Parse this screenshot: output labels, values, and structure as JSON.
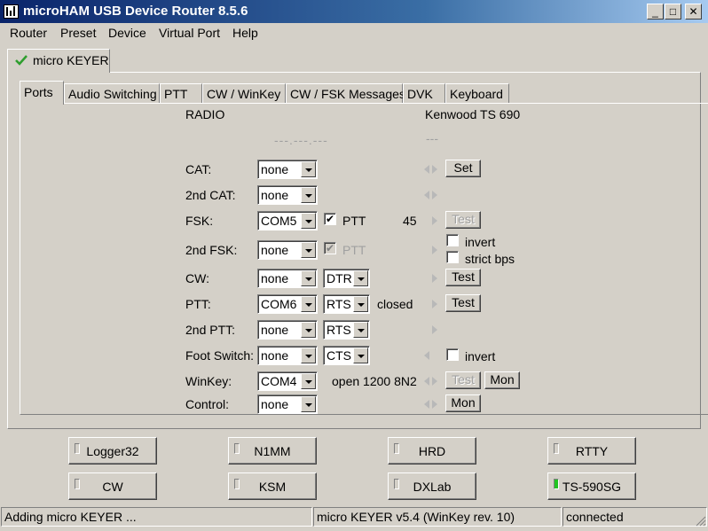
{
  "window": {
    "title": "microHAM USB Device Router 8.5.6",
    "min_glyph": "_",
    "max_glyph": "□",
    "close_glyph": "✕"
  },
  "menu": [
    "Router",
    "Preset",
    "Device",
    "Virtual Port",
    "Help"
  ],
  "device_tab": "micro KEYER",
  "tabs": [
    "Ports",
    "Audio Switching",
    "PTT",
    "CW / WinKey",
    "CW / FSK Messages",
    "DVK",
    "Keyboard"
  ],
  "ports": {
    "radio_label": "RADIO",
    "radio_model": "Kenwood TS 690",
    "radio_freq": "---.---.---",
    "radio_mode": "---",
    "rows": {
      "cat": {
        "label": "CAT:",
        "port": "none",
        "button": "Set"
      },
      "cat2": {
        "label": "2nd CAT:",
        "port": "none"
      },
      "fsk": {
        "label": "FSK:",
        "port": "COM5",
        "ptt": "PTT",
        "baud": "45",
        "button": "Test"
      },
      "fsk2": {
        "label": "2nd FSK:",
        "port": "none",
        "ptt": "PTT",
        "invert": "invert",
        "strict": "strict bps"
      },
      "cw": {
        "label": "CW:",
        "port": "none",
        "line": "DTR",
        "button": "Test"
      },
      "ptt": {
        "label": "PTT:",
        "port": "COM6",
        "line": "RTS",
        "state": "closed",
        "button": "Test"
      },
      "ptt2": {
        "label": "2nd PTT:",
        "port": "none",
        "line": "RTS"
      },
      "foot": {
        "label": "Foot Switch:",
        "port": "none",
        "line": "CTS",
        "invert": "invert"
      },
      "winkey": {
        "label": "WinKey:",
        "port": "COM4",
        "state": "open 1200 8N2",
        "test": "Test",
        "mon": "Mon"
      },
      "control": {
        "label": "Control:",
        "port": "none",
        "mon": "Mon"
      }
    }
  },
  "apps": [
    "Logger32",
    "N1MM",
    "HRD",
    "RTTY",
    "CW",
    "KSM",
    "DXLab",
    "TS-590SG"
  ],
  "status": {
    "message": "Adding micro KEYER ...",
    "device": "micro KEYER v5.4 (WinKey rev. 10)",
    "state": "connected"
  },
  "colors": {
    "title_start": "#0a246a",
    "led_active": "#22c422",
    "face": "#d4d0c8"
  }
}
